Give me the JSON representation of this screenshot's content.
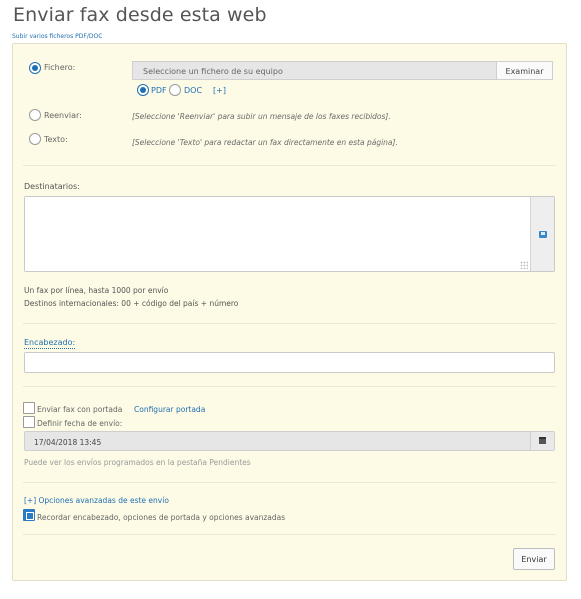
{
  "page": {
    "title": "Enviar fax desde esta web",
    "multi_upload_link": "Subir varios ficheros PDF/DOC"
  },
  "source": {
    "file_label": "Fichero:",
    "file_placeholder": "Seleccione un fichero de su equipo",
    "browse_label": "Examinar",
    "format_pdf": "PDF",
    "format_doc": "DOC",
    "more_label": "[+]",
    "forward_label": "Reenviar:",
    "forward_hint": "[Seleccione 'Reenviar' para subir un mensaje de los faxes recibidos].",
    "text_label": "Texto:",
    "text_hint": "[Seleccione 'Texto' para redactar un fax directamente en esta página]."
  },
  "recipients": {
    "label": "Destinatarios:",
    "value": "",
    "help_line1": "Un fax por línea, hasta 1000 por envío",
    "help_line2": "Destinos internacionales: 00 + código del país + número"
  },
  "header_field": {
    "label": "Encabezado:",
    "value": ""
  },
  "options": {
    "cover_label": "Enviar fax con portada",
    "cover_config_link": "Configurar portada",
    "schedule_label": "Definir fecha de envío:",
    "schedule_value": "17/04/2018 13:45",
    "schedule_note": "Puede ver los envíos programados en la pestaña Pendientes",
    "advanced_link": "[+] Opciones avanzadas de este envío",
    "remember_label": "Recordar encabezado, opciones de portada y opciones avanzadas"
  },
  "actions": {
    "send_label": "Enviar"
  },
  "colors": {
    "panel_bg": "#fdfbe6",
    "accent": "#1f6fb2"
  }
}
